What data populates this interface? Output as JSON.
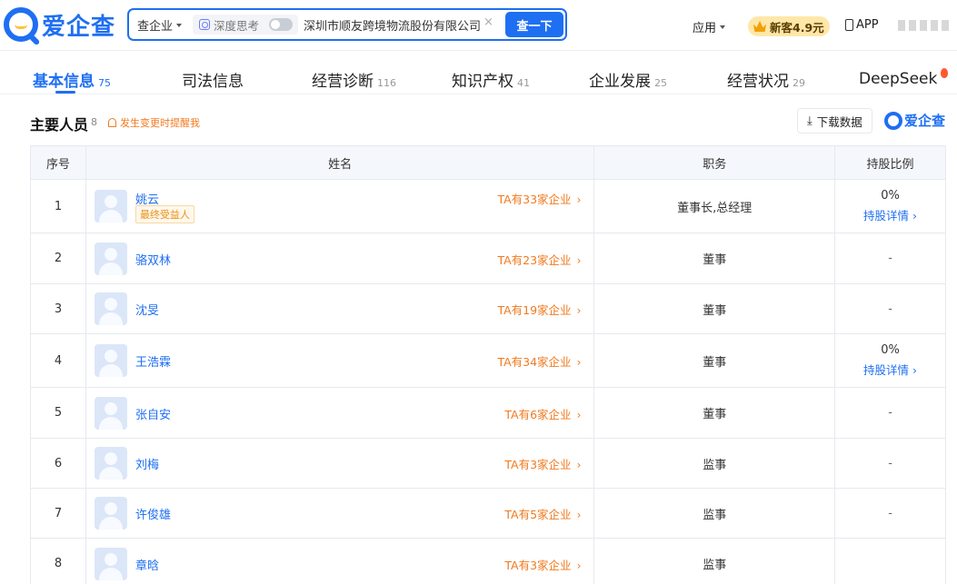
{
  "header": {
    "logo_text": "爱企查",
    "search_type": "查企业",
    "deep_think_label": "深度思考",
    "query": "深圳市顺友跨境物流股份有限公司",
    "clear_symbol": "×",
    "search_button": "查一下",
    "apps_label": "应用",
    "promo_label": "新客4.9元",
    "app_label": "APP"
  },
  "tabs": [
    {
      "label": "基本信息",
      "count": "75",
      "active": true
    },
    {
      "label": "司法信息",
      "count": ""
    },
    {
      "label": "经营诊断",
      "count": "116"
    },
    {
      "label": "知识产权",
      "count": "41"
    },
    {
      "label": "企业发展",
      "count": "25"
    },
    {
      "label": "经营状况",
      "count": "29"
    },
    {
      "label": "DeepSeek",
      "count": ""
    }
  ],
  "section": {
    "title": "主要人员",
    "count": "8",
    "alert": "发生变更时提醒我",
    "download": "下载数据",
    "brand": "爱企查"
  },
  "table": {
    "headers": [
      "序号",
      "姓名",
      "职务",
      "持股比例"
    ],
    "share_detail_label": "持股详情",
    "rows": [
      {
        "no": "1",
        "name": "姚云",
        "tag": "最终受益人",
        "firms": "TA有33家企业",
        "role": "董事长,总经理",
        "share": "0%",
        "share_detail": true
      },
      {
        "no": "2",
        "name": "骆双林",
        "tag": "",
        "firms": "TA有23家企业",
        "role": "董事",
        "share": "-",
        "share_detail": false
      },
      {
        "no": "3",
        "name": "沈旻",
        "tag": "",
        "firms": "TA有19家企业",
        "role": "董事",
        "share": "-",
        "share_detail": false
      },
      {
        "no": "4",
        "name": "王浩霖",
        "tag": "",
        "firms": "TA有34家企业",
        "role": "董事",
        "share": "0%",
        "share_detail": true
      },
      {
        "no": "5",
        "name": "张自安",
        "tag": "",
        "firms": "TA有6家企业",
        "role": "董事",
        "share": "-",
        "share_detail": false
      },
      {
        "no": "6",
        "name": "刘梅",
        "tag": "",
        "firms": "TA有3家企业",
        "role": "监事",
        "share": "-",
        "share_detail": false
      },
      {
        "no": "7",
        "name": "许俊雄",
        "tag": "",
        "firms": "TA有5家企业",
        "role": "监事",
        "share": "-",
        "share_detail": false
      },
      {
        "no": "8",
        "name": "章晗",
        "tag": "",
        "firms": "TA有3家企业",
        "role": "监事",
        "share": "",
        "share_detail": false
      }
    ]
  },
  "colors": {
    "accent": "#1f6ff2",
    "orange": "#f07a1f"
  }
}
